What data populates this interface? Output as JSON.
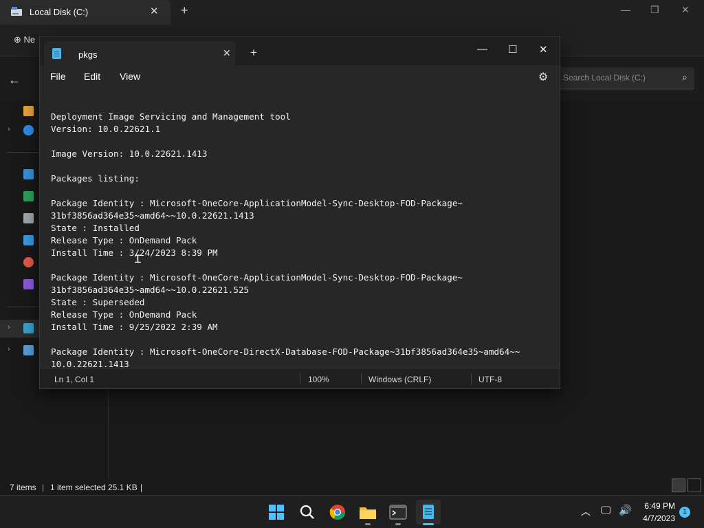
{
  "explorer": {
    "tab_title": "Local Disk (C:)",
    "new_label": "Ne",
    "search_placeholder": "Search Local Disk (C:)",
    "status": {
      "items": "7 items",
      "selected": "1 item selected",
      "size": "25.1 KB"
    }
  },
  "notepad": {
    "tab_title": "pkgs",
    "menu": [
      "File",
      "Edit",
      "View"
    ],
    "content": "Deployment Image Servicing and Management tool\nVersion: 10.0.22621.1\n\nImage Version: 10.0.22621.1413\n\nPackages listing:\n\nPackage Identity : Microsoft-OneCore-ApplicationModel-Sync-Desktop-FOD-Package~\n31bf3856ad364e35~amd64~~10.0.22621.1413\nState : Installed\nRelease Type : OnDemand Pack\nInstall Time : 3/24/2023 8:39 PM\n\nPackage Identity : Microsoft-OneCore-ApplicationModel-Sync-Desktop-FOD-Package~\n31bf3856ad364e35~amd64~~10.0.22621.525\nState : Superseded\nRelease Type : OnDemand Pack\nInstall Time : 9/25/2022 2:39 AM\n\nPackage Identity : Microsoft-OneCore-DirectX-Database-FOD-Package~31bf3856ad364e35~amd64~~\n10.0.22621.1413",
    "status": {
      "position": "Ln 1, Col 1",
      "zoom": "100%",
      "line_ending": "Windows (CRLF)",
      "encoding": "UTF-8"
    }
  },
  "taskbar": {
    "time": "6:49 PM",
    "date": "4/7/2023",
    "notification_count": "1"
  }
}
